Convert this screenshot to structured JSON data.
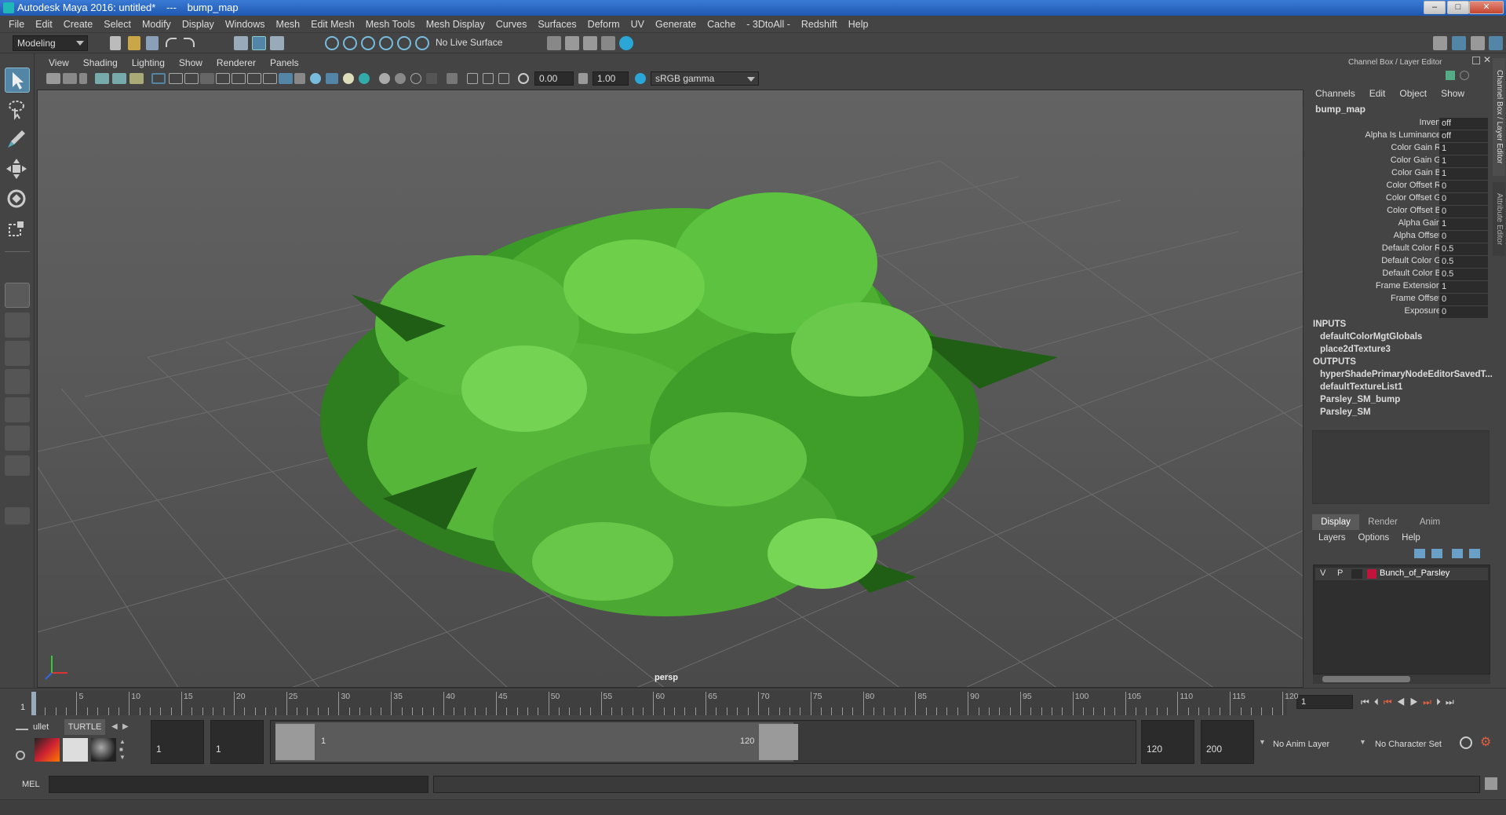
{
  "title": {
    "app": "Autodesk Maya 2016: untitled*",
    "sep": "---",
    "node": "bump_map"
  },
  "menubar": [
    "File",
    "Edit",
    "Create",
    "Select",
    "Modify",
    "Display",
    "Windows",
    "Mesh",
    "Edit Mesh",
    "Mesh Tools",
    "Mesh Display",
    "Curves",
    "Surfaces",
    "Deform",
    "UV",
    "Generate",
    "Cache",
    "- 3DtoAll -",
    "Redshift",
    "Help"
  ],
  "statusline": {
    "mode": "Modeling",
    "live_surface": "No Live Surface"
  },
  "viewport": {
    "menu": [
      "View",
      "Shading",
      "Lighting",
      "Show",
      "Renderer",
      "Panels"
    ],
    "exposure": "0.00",
    "gamma": "1.00",
    "color_space": "sRGB gamma",
    "camera": "persp"
  },
  "channelbox": {
    "title": "Channel Box / Layer Editor",
    "menu": [
      "Channels",
      "Edit",
      "Object",
      "Show"
    ],
    "node": "bump_map",
    "attrs": [
      {
        "label": "Invert",
        "value": "off"
      },
      {
        "label": "Alpha Is Luminance",
        "value": "off"
      },
      {
        "label": "Color Gain R",
        "value": "1"
      },
      {
        "label": "Color Gain G",
        "value": "1"
      },
      {
        "label": "Color Gain B",
        "value": "1"
      },
      {
        "label": "Color Offset R",
        "value": "0"
      },
      {
        "label": "Color Offset G",
        "value": "0"
      },
      {
        "label": "Color Offset B",
        "value": "0"
      },
      {
        "label": "Alpha Gain",
        "value": "1"
      },
      {
        "label": "Alpha Offset",
        "value": "0"
      },
      {
        "label": "Default Color R",
        "value": "0.5"
      },
      {
        "label": "Default Color G",
        "value": "0.5"
      },
      {
        "label": "Default Color B",
        "value": "0.5"
      },
      {
        "label": "Frame Extension",
        "value": "1"
      },
      {
        "label": "Frame Offset",
        "value": "0"
      },
      {
        "label": "Exposure",
        "value": "0"
      }
    ],
    "inputs_header": "INPUTS",
    "inputs": [
      "defaultColorMgtGlobals",
      "place2dTexture3"
    ],
    "outputs_header": "OUTPUTS",
    "outputs": [
      "hyperShadePrimaryNodeEditorSavedT...",
      "defaultTextureList1",
      "Parsley_SM_bump",
      "Parsley_SM"
    ]
  },
  "side_tabs": [
    "Channel Box / Layer Editor",
    "Attribute Editor"
  ],
  "layer_editor": {
    "tabs": [
      "Display",
      "Render",
      "Anim"
    ],
    "menu": [
      "Layers",
      "Options",
      "Help"
    ],
    "layer": {
      "v": "V",
      "p": "P",
      "name": "Bunch_of_Parsley",
      "color": "#c0143c"
    }
  },
  "timeline": {
    "ticks": [
      "5",
      "10",
      "15",
      "20",
      "25",
      "30",
      "35",
      "40",
      "45",
      "50",
      "55",
      "60",
      "65",
      "70",
      "75",
      "80",
      "85",
      "90",
      "95",
      "100",
      "105",
      "110",
      "115",
      "120"
    ],
    "current_start": "1",
    "current_frame": "1"
  },
  "range": {
    "shelf_tabs": [
      "ullet",
      "TURTLE"
    ],
    "start": "1",
    "anim_start": "1",
    "range_start": "1",
    "range_end": "120",
    "end": "120",
    "anim_end": "200",
    "anim_layer": "No Anim Layer",
    "char_set": "No Character Set"
  },
  "command": {
    "label": "MEL"
  },
  "colors": {
    "accent": "#5285a6",
    "leaf": "#3fa52a",
    "layer_red": "#c0143c"
  }
}
